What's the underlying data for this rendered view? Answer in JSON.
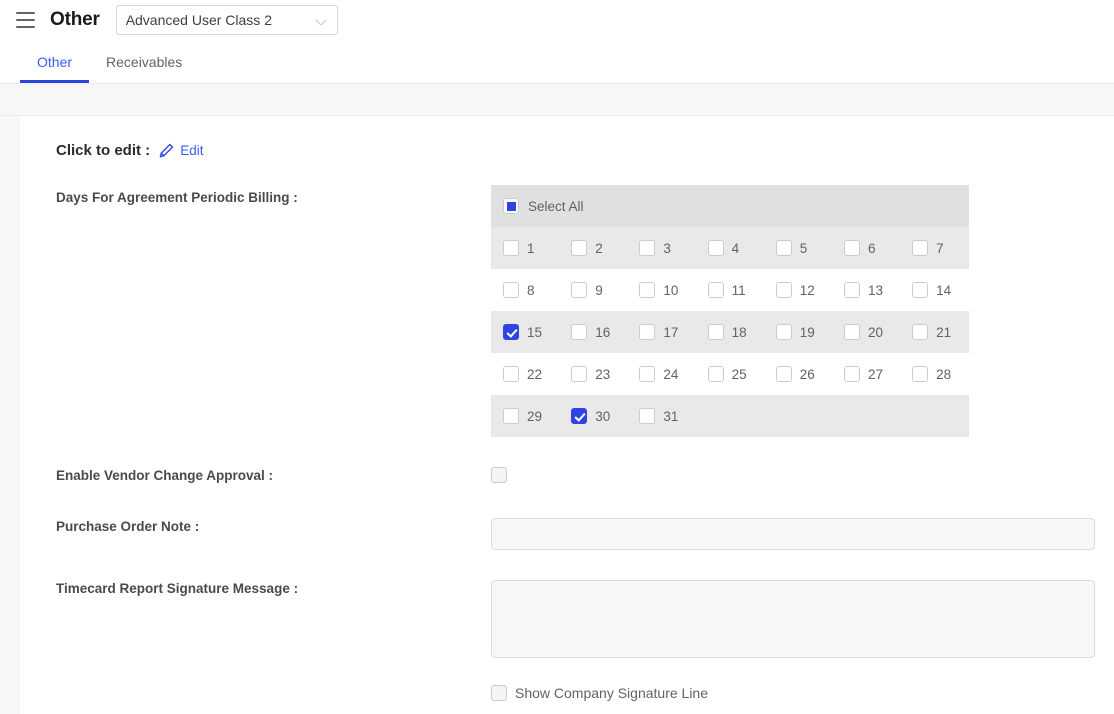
{
  "topbar": {
    "menu_icon": "hamburger-icon",
    "title": "Other",
    "class_select": {
      "value": "Advanced User Class 2",
      "chevron_icon": "chevron-down-icon"
    }
  },
  "tabs": [
    {
      "label": "Other",
      "active": true
    },
    {
      "label": "Receivables",
      "active": false
    }
  ],
  "edit_header": {
    "label": "Click to edit :",
    "pencil_icon": "pencil-edit-icon",
    "link_label": "Edit"
  },
  "fields": {
    "days_billing": {
      "label": "Days For Agreement Periodic Billing :",
      "select_all_label": "Select All",
      "select_all_state": "indeterminate",
      "days": [
        {
          "n": "1",
          "checked": false
        },
        {
          "n": "2",
          "checked": false
        },
        {
          "n": "3",
          "checked": false
        },
        {
          "n": "4",
          "checked": false
        },
        {
          "n": "5",
          "checked": false
        },
        {
          "n": "6",
          "checked": false
        },
        {
          "n": "7",
          "checked": false
        },
        {
          "n": "8",
          "checked": false
        },
        {
          "n": "9",
          "checked": false
        },
        {
          "n": "10",
          "checked": false
        },
        {
          "n": "11",
          "checked": false
        },
        {
          "n": "12",
          "checked": false
        },
        {
          "n": "13",
          "checked": false
        },
        {
          "n": "14",
          "checked": false
        },
        {
          "n": "15",
          "checked": true
        },
        {
          "n": "16",
          "checked": false
        },
        {
          "n": "17",
          "checked": false
        },
        {
          "n": "18",
          "checked": false
        },
        {
          "n": "19",
          "checked": false
        },
        {
          "n": "20",
          "checked": false
        },
        {
          "n": "21",
          "checked": false
        },
        {
          "n": "22",
          "checked": false
        },
        {
          "n": "23",
          "checked": false
        },
        {
          "n": "24",
          "checked": false
        },
        {
          "n": "25",
          "checked": false
        },
        {
          "n": "26",
          "checked": false
        },
        {
          "n": "27",
          "checked": false
        },
        {
          "n": "28",
          "checked": false
        },
        {
          "n": "29",
          "checked": false
        },
        {
          "n": "30",
          "checked": true
        },
        {
          "n": "31",
          "checked": false
        }
      ]
    },
    "vendor_approval": {
      "label": "Enable Vendor Change Approval  :",
      "checked": false
    },
    "purchase_order_note": {
      "label": "Purchase Order Note :",
      "value": "",
      "placeholder": ""
    },
    "timecard_signature": {
      "label": "Timecard Report Signature Message :",
      "value": "",
      "placeholder": ""
    },
    "show_signature_line": {
      "label": "Show Company Signature Line",
      "checked": false
    }
  },
  "colors": {
    "accent": "#2f44e0",
    "link": "#3b5cf0",
    "label": "#4a4a4a",
    "muted": "#5f6368",
    "grid_header": "#e0e0e0",
    "grid_odd": "#e9e9e9",
    "page_bg": "#f7f7f8"
  }
}
